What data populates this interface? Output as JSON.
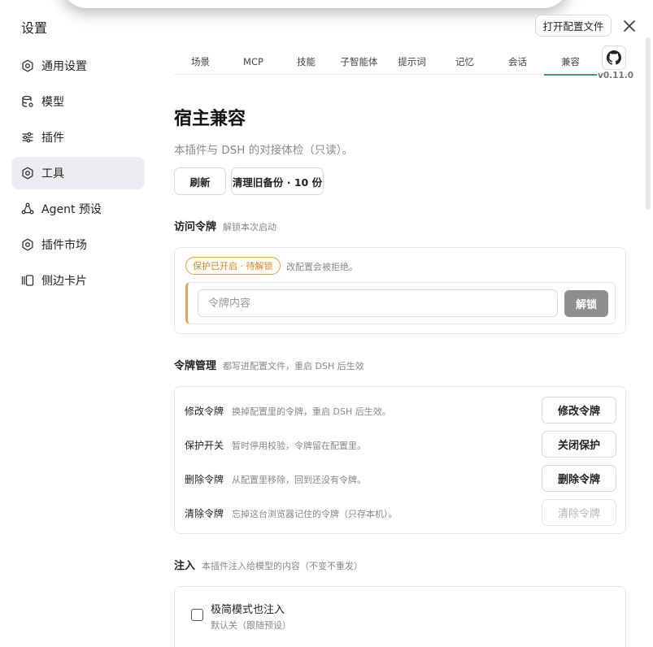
{
  "window": {
    "title": "设置",
    "open_config_label": "打开配置文件",
    "close_icon": "close-icon"
  },
  "sidebar": {
    "items": [
      {
        "label": "通用设置",
        "icon": "gear-icon",
        "active": false
      },
      {
        "label": "模型",
        "icon": "database-icon",
        "active": false
      },
      {
        "label": "插件",
        "icon": "sliders-icon",
        "active": false
      },
      {
        "label": "工具",
        "icon": "gear-icon",
        "active": true
      },
      {
        "label": "Agent 预设",
        "icon": "agent-icon",
        "active": false
      },
      {
        "label": "插件市场",
        "icon": "gear-icon",
        "active": false
      },
      {
        "label": "侧边卡片",
        "icon": "cards-icon",
        "active": false
      }
    ]
  },
  "tabs": {
    "items": [
      "场景",
      "MCP",
      "技能",
      "子智能体",
      "提示词",
      "记忆",
      "会话",
      "兼容"
    ],
    "active": "兼容",
    "github_icon": "github-icon",
    "version": "v0.11.0"
  },
  "page": {
    "title": "宿主兼容",
    "subtitle": "本插件与 DSH 的对接体检（只读）。",
    "refresh_label": "刷新",
    "clean_backup_label": "清理旧备份 · 10 份"
  },
  "access_token": {
    "title": "访问令牌",
    "hint": "解锁本次启动",
    "badge": "保护已开启 · 待解锁",
    "badge_note": "改配置会被拒绝。",
    "input_placeholder": "令牌内容",
    "unlock_label": "解锁"
  },
  "token_mgmt": {
    "title": "令牌管理",
    "hint": "都写进配置文件，重启 DSH 后生效",
    "rows": [
      {
        "label": "修改令牌",
        "desc": "换掉配置里的令牌，重启 DSH 后生效。",
        "button": "修改令牌",
        "disabled": false
      },
      {
        "label": "保护开关",
        "desc": "暂时停用校验，令牌留在配置里。",
        "button": "关闭保护",
        "disabled": false
      },
      {
        "label": "删除令牌",
        "desc": "从配置里移除，回到还没有令牌。",
        "button": "删除令牌",
        "disabled": false
      },
      {
        "label": "清除令牌",
        "desc": "忘掉这台浏览器记住的令牌（只存本机）。",
        "button": "清除令牌",
        "disabled": true
      }
    ]
  },
  "inject": {
    "title": "注入",
    "hint": "本插件注入给模型的内容（不变不重发）",
    "checkbox_label": "极简模式也注入",
    "checkbox_hint": "默认关（跟随预设）",
    "checked": false
  }
}
